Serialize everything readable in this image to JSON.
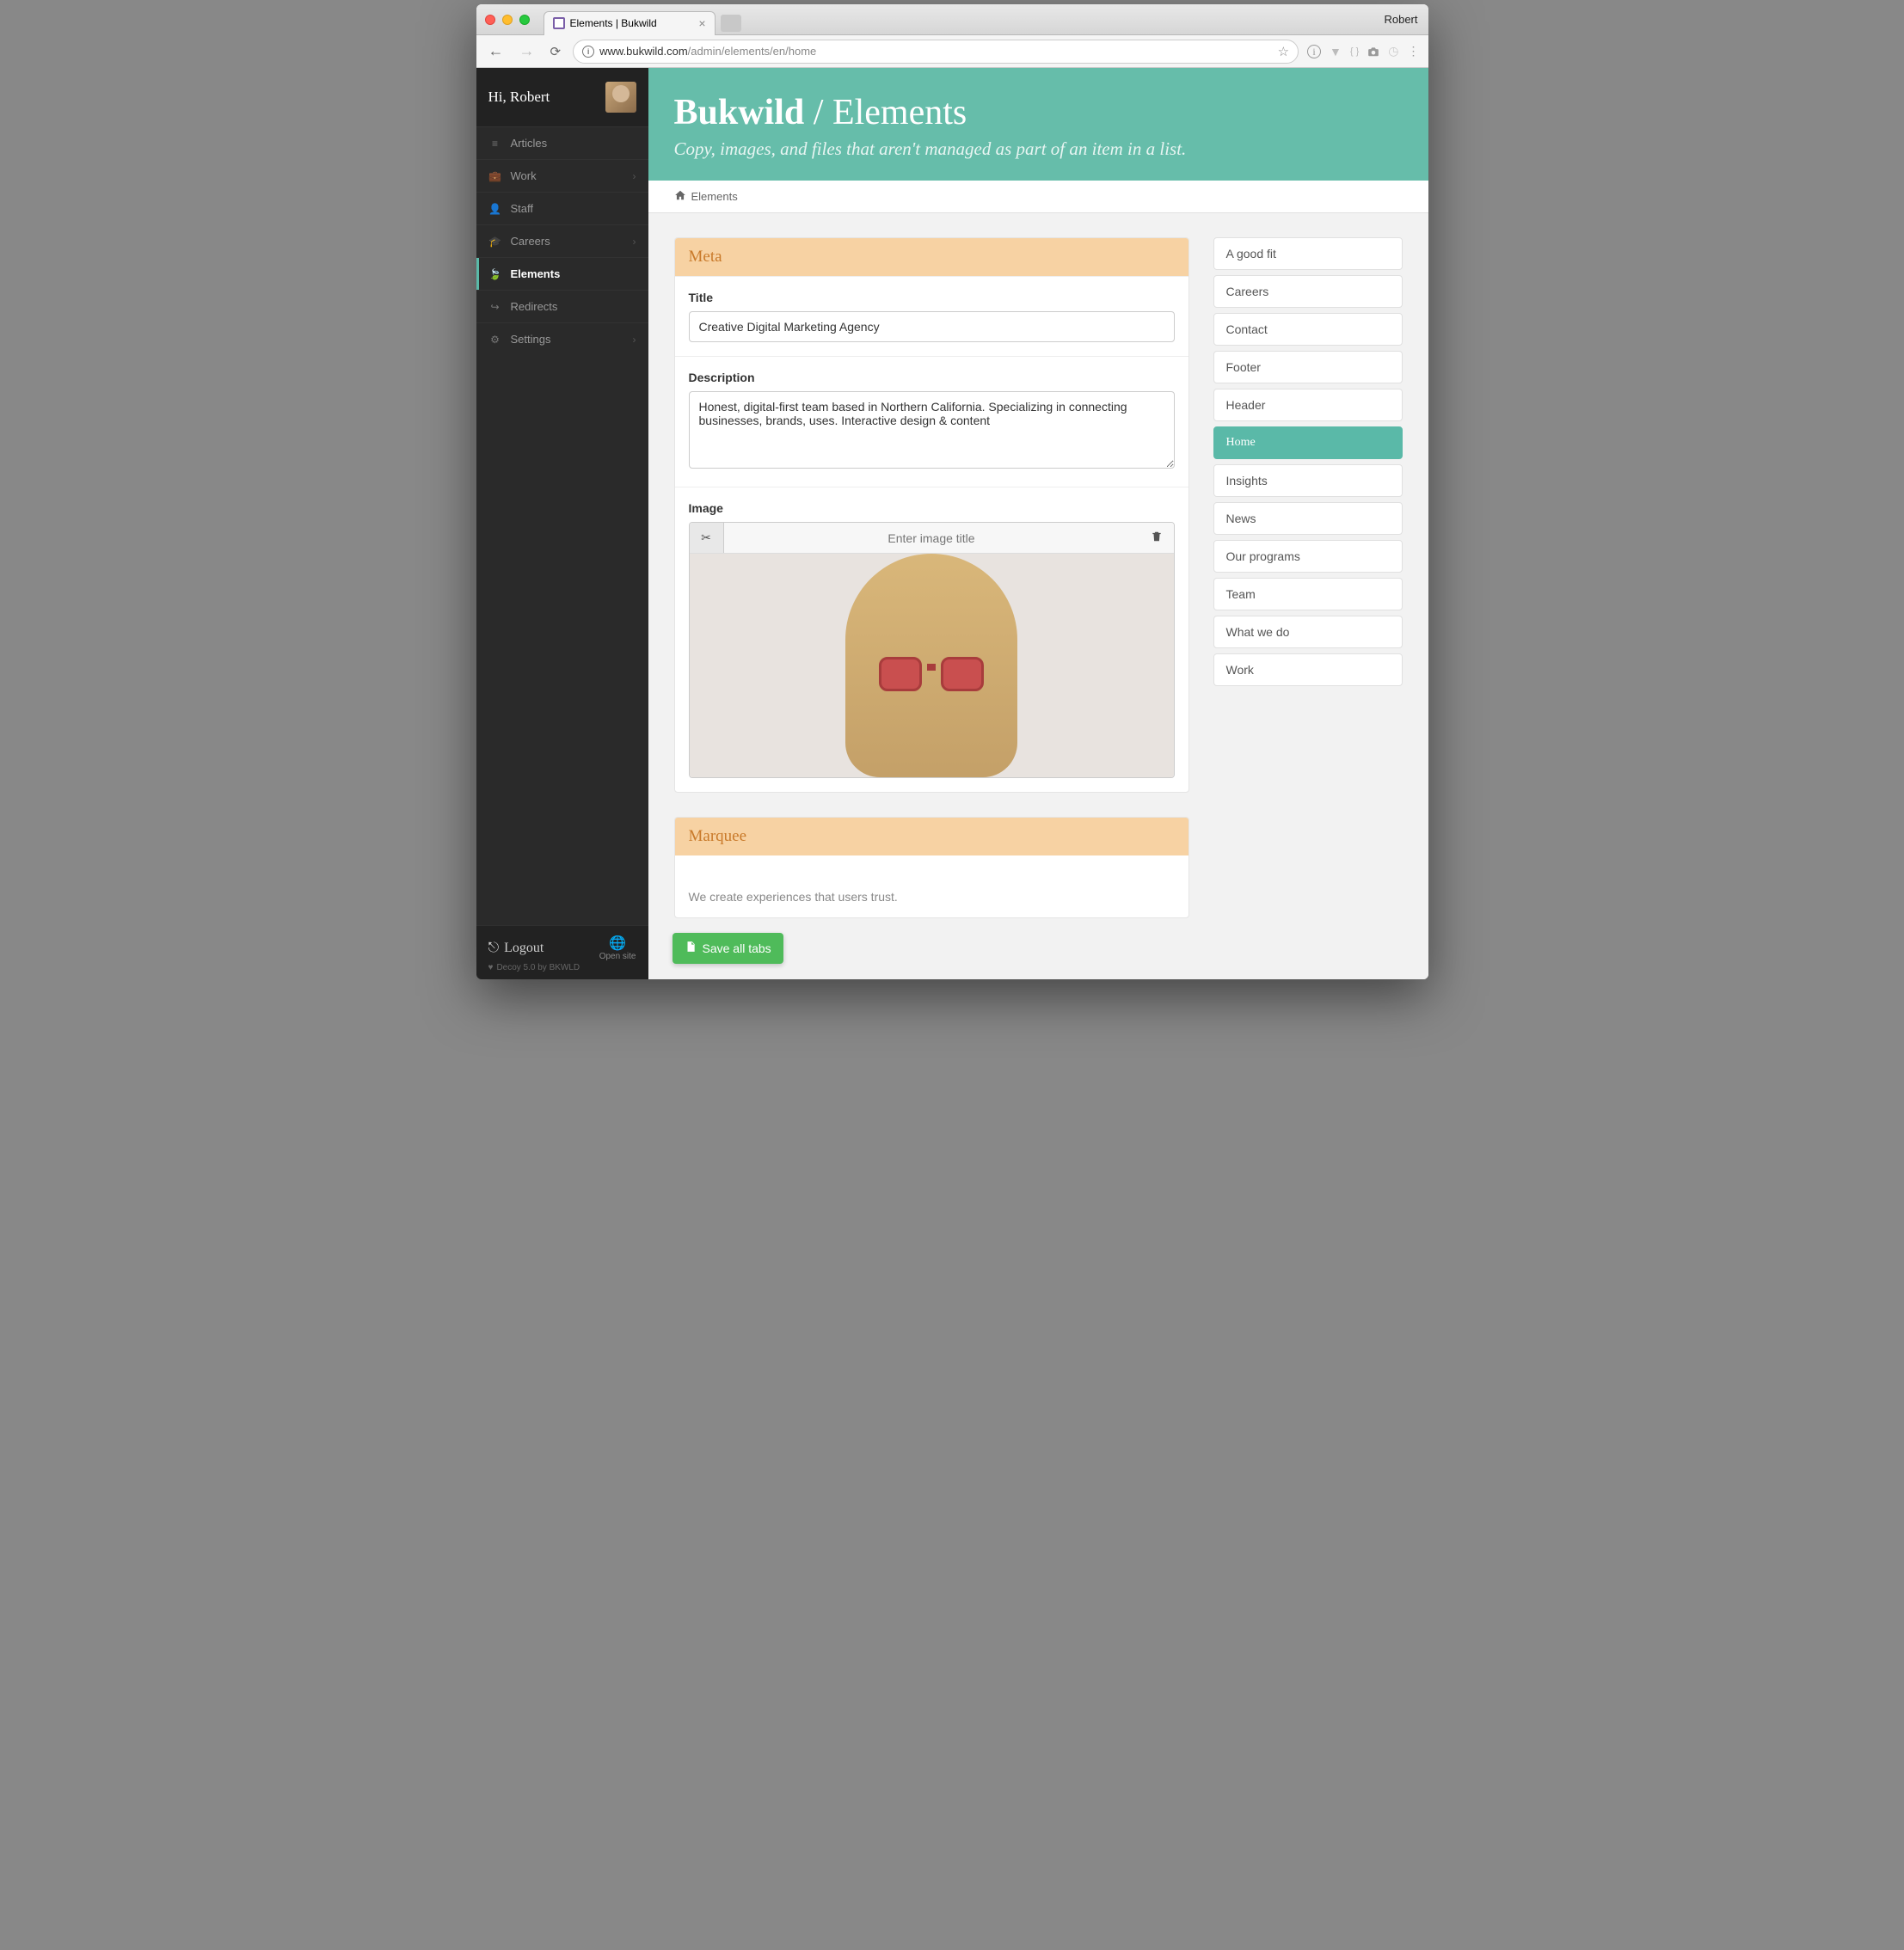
{
  "mac": {
    "user": "Robert"
  },
  "browser": {
    "tab_title": "Elements | Bukwild",
    "url_prefix": "www.bukwild.com",
    "url_path": "/admin/elements/en/home"
  },
  "sidebar": {
    "greeting": "Hi, Robert",
    "items": [
      {
        "label": "Articles",
        "icon": "≡",
        "chevron": false
      },
      {
        "label": "Work",
        "icon": "💼",
        "chevron": true
      },
      {
        "label": "Staff",
        "icon": "👤",
        "chevron": false
      },
      {
        "label": "Careers",
        "icon": "🎓",
        "chevron": true
      },
      {
        "label": "Elements",
        "icon": "🍃",
        "chevron": false,
        "active": true
      },
      {
        "label": "Redirects",
        "icon": "↪",
        "chevron": false
      },
      {
        "label": "Settings",
        "icon": "⚙",
        "chevron": true
      }
    ],
    "logout": "Logout",
    "open_site": "Open site",
    "credit": "Decoy 5.0 by BKWLD"
  },
  "hero": {
    "brand": "Bukwild",
    "section": "Elements",
    "subtitle": "Copy, images, and files that aren't managed as part of an item in a list."
  },
  "breadcrumb": {
    "label": "Elements"
  },
  "panels": {
    "meta": {
      "title": "Meta",
      "fields": {
        "title_label": "Title",
        "title_value": "Creative Digital Marketing Agency",
        "description_label": "Description",
        "description_value": "Honest, digital-first team based in Northern California. Specializing in connecting businesses, brands, uses. Interactive design & content",
        "image_label": "Image",
        "image_title_placeholder": "Enter image title"
      }
    },
    "marquee": {
      "title": "Marquee",
      "body": "We create experiences that users trust."
    }
  },
  "save_button": "Save all tabs",
  "side_nav": [
    "A good fit",
    "Careers",
    "Contact",
    "Footer",
    "Header",
    "Home",
    "Insights",
    "News",
    "Our programs",
    "Team",
    "What we do",
    "Work"
  ],
  "side_nav_active": "Home"
}
